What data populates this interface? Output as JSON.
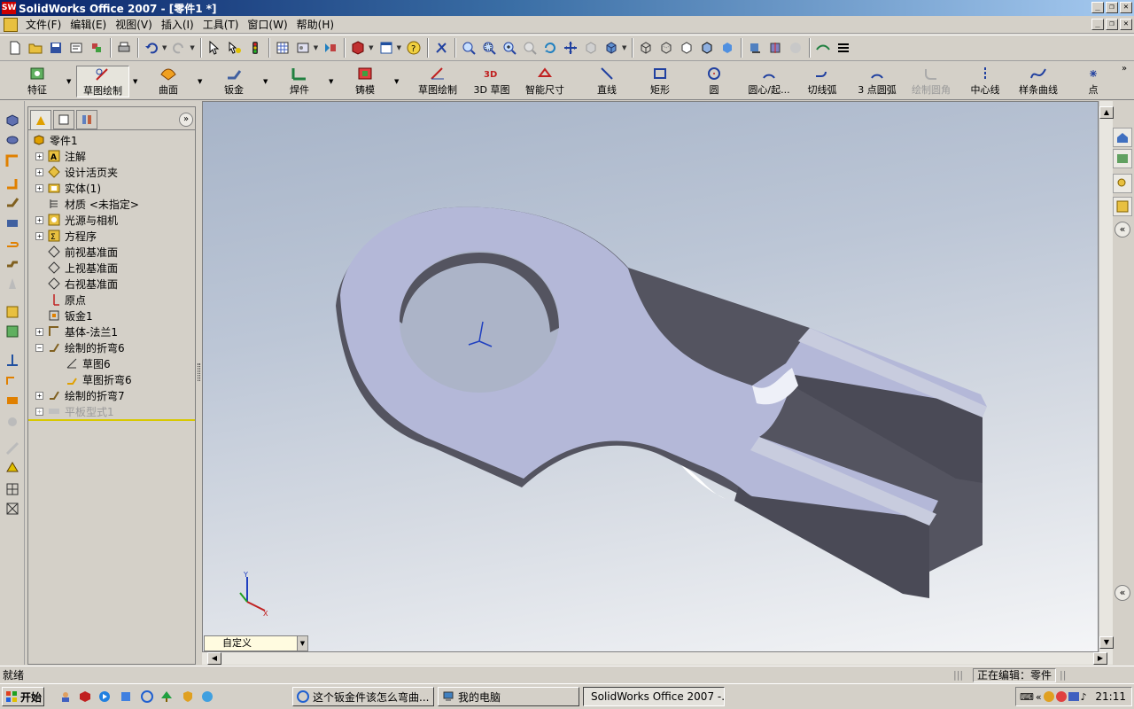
{
  "window": {
    "title": "SolidWorks Office 2007 - [零件1 *]",
    "app_icon_text": "SW"
  },
  "menu": {
    "items": [
      "文件(F)",
      "编辑(E)",
      "视图(V)",
      "插入(I)",
      "工具(T)",
      "窗口(W)",
      "帮助(H)"
    ]
  },
  "command_manager": {
    "items": [
      {
        "label": "特征",
        "icon": "features-icon"
      },
      {
        "label": "草图绘制",
        "icon": "sketch-icon",
        "active": true
      },
      {
        "label": "曲面",
        "icon": "surfaces-icon"
      },
      {
        "label": "钣金",
        "icon": "sheet-metal-icon"
      },
      {
        "label": "焊件",
        "icon": "weldments-icon"
      },
      {
        "label": "铸模",
        "icon": "mold-icon"
      },
      {
        "label": "草图绘制",
        "icon": "sketch-tool-icon"
      },
      {
        "label": "3D 草图",
        "icon": "3d-sketch-icon"
      },
      {
        "label": "智能尺寸",
        "icon": "smart-dimension-icon"
      },
      {
        "label": "直线",
        "icon": "line-icon"
      },
      {
        "label": "矩形",
        "icon": "rectangle-icon"
      },
      {
        "label": "圆",
        "icon": "circle-icon"
      },
      {
        "label": "圆心/起...",
        "icon": "centerpoint-arc-icon"
      },
      {
        "label": "切线弧",
        "icon": "tangent-arc-icon"
      },
      {
        "label": "3 点圆弧",
        "icon": "3point-arc-icon"
      },
      {
        "label": "绘制圆角",
        "icon": "sketch-fillet-icon",
        "disabled": true
      },
      {
        "label": "中心线",
        "icon": "centerline-icon"
      },
      {
        "label": "样条曲线",
        "icon": "spline-icon"
      },
      {
        "label": "点",
        "icon": "point-icon"
      }
    ]
  },
  "feature_tree": {
    "root": "零件1",
    "nodes": [
      {
        "label": "注解",
        "expandable": true,
        "icon": "annotations-icon"
      },
      {
        "label": "设计活页夹",
        "expandable": true,
        "icon": "design-binder-icon"
      },
      {
        "label": "实体(1)",
        "expandable": true,
        "icon": "solid-bodies-icon"
      },
      {
        "label": "材质 <未指定>",
        "expandable": false,
        "icon": "material-icon"
      },
      {
        "label": "光源与相机",
        "expandable": true,
        "icon": "lights-cameras-icon"
      },
      {
        "label": "方程序",
        "expandable": true,
        "icon": "equations-icon"
      },
      {
        "label": "前视基准面",
        "expandable": false,
        "icon": "plane-icon"
      },
      {
        "label": "上视基准面",
        "expandable": false,
        "icon": "plane-icon"
      },
      {
        "label": "右视基准面",
        "expandable": false,
        "icon": "plane-icon"
      },
      {
        "label": "原点",
        "expandable": false,
        "icon": "origin-icon"
      },
      {
        "label": "钣金1",
        "expandable": false,
        "icon": "sheet-metal-feature-icon"
      },
      {
        "label": "基体-法兰1",
        "expandable": true,
        "icon": "base-flange-icon"
      },
      {
        "label": "绘制的折弯6",
        "expandable": true,
        "expanded": true,
        "icon": "sketched-bend-icon"
      },
      {
        "label": "草图6",
        "child": true,
        "icon": "sketch-node-icon"
      },
      {
        "label": "草图折弯6",
        "child": true,
        "icon": "sketch-bend-icon"
      },
      {
        "label": "绘制的折弯7",
        "expandable": true,
        "icon": "sketched-bend-icon"
      },
      {
        "label": "平板型式1",
        "expandable": true,
        "disabled": true,
        "icon": "flat-pattern-icon"
      }
    ]
  },
  "viewport": {
    "config_combo": "自定义",
    "triad_x": "X",
    "triad_y": "Y",
    "colors": {
      "part_face": "#b4b8d8",
      "part_side": "#545460",
      "background_top": "#a7b4c8",
      "background_bottom": "#f4f5f7"
    }
  },
  "status": {
    "left": "就绪",
    "editing": "正在编辑：零件"
  },
  "taskbar": {
    "start": "开始",
    "tasks": [
      {
        "label": "这个钣金件该怎么弯曲...",
        "icon": "ie-icon"
      },
      {
        "label": "我的电脑",
        "icon": "computer-icon"
      },
      {
        "label": "SolidWorks Office 2007 -...",
        "icon": "solidworks-icon",
        "active": true
      }
    ],
    "clock": "21:11"
  }
}
